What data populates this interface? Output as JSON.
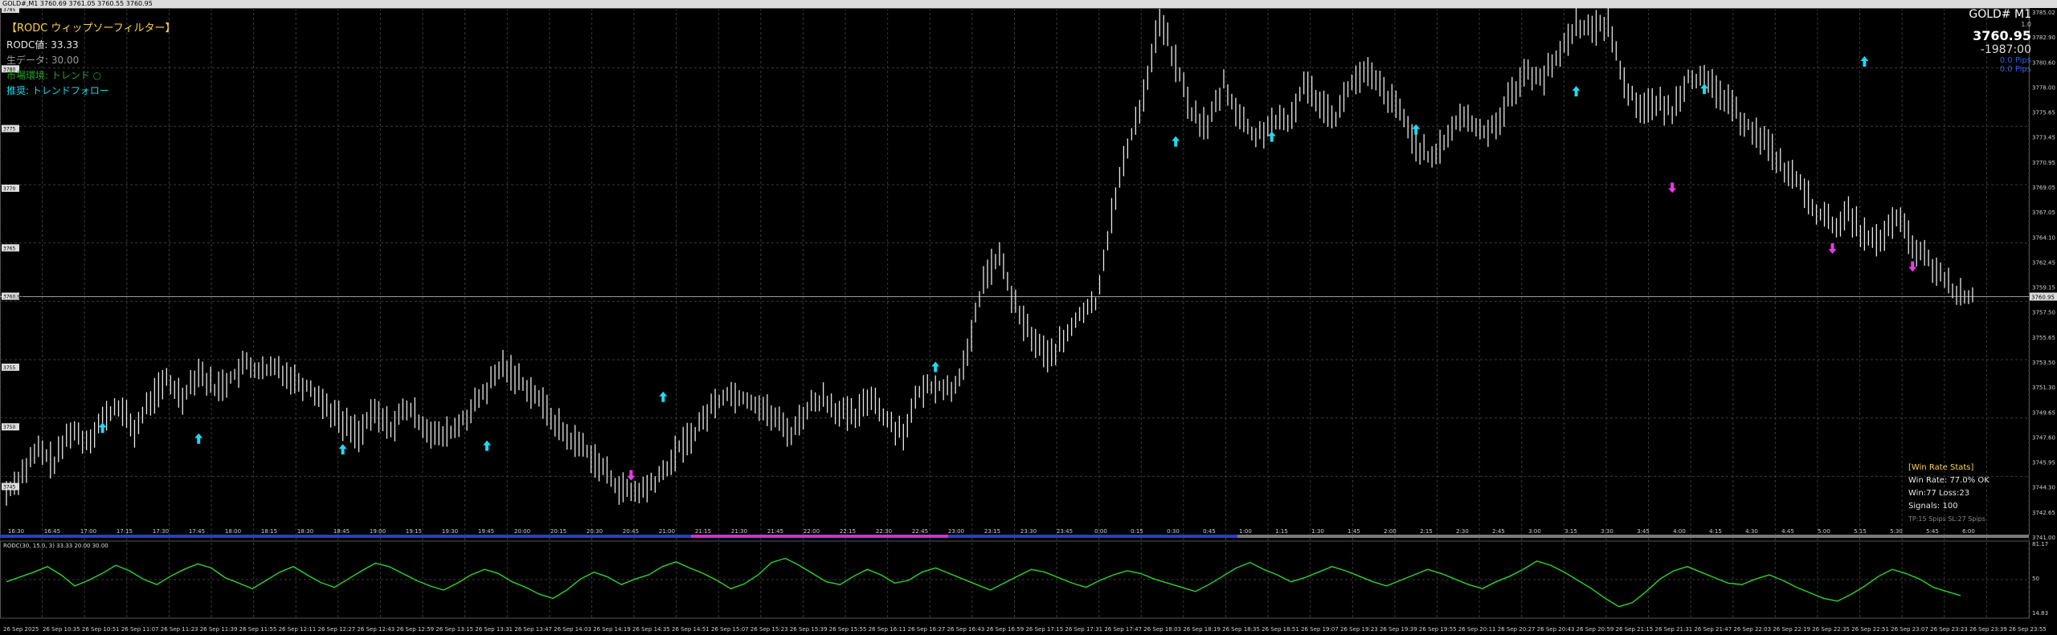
{
  "window": {
    "title": "GOLD#,M1  3760.69 3761.05 3760.55 3760.95"
  },
  "symbol": {
    "name": "GOLD#",
    "timeframe": "M1",
    "spread_ratio": "1.0",
    "price": "3760.95",
    "countdown": "-1987:00",
    "pips1": "0.0 Pips",
    "pips2": "0.0 Pips"
  },
  "indicator_panel": {
    "title": "【RODC ウィップソーフィルター】",
    "value_line": "RODC値: 33.33",
    "raw_line": "生データ: 30.00",
    "env_line": "市場環境: トレンド ○",
    "rec_line": "推奨: トレンドフォロー"
  },
  "stats": {
    "header": "[Win Rate Stats]",
    "win_rate": "Win Rate: 77.0% OK",
    "win_loss": "Win:77 Loss:23",
    "signals": "Signals: 100",
    "tp_sl": "TP:15 Spips SL:27 Spips"
  },
  "subwindow": {
    "title": "RODC(30, 15.0, 3) 33.33 20.00 30.00",
    "levels": [
      "81.17",
      "50",
      "14.83"
    ]
  },
  "price_axis": [
    "3785.02",
    "3782.90",
    "3780.60",
    "3778.00",
    "3775.65",
    "3773.45",
    "3770.95",
    "3769.05",
    "3767.05",
    "3764.10",
    "3762.45",
    "3759.15",
    "3757.50",
    "3755.65",
    "3753.50",
    "3751.30",
    "3749.65",
    "3747.60",
    "3745.95",
    "3744.30",
    "3742.65",
    "3741.00"
  ],
  "axis_marks": [
    "3785",
    "3780",
    "3775",
    "3770",
    "3765",
    "3760.95",
    "3755",
    "3750",
    "3745"
  ],
  "time_strip": [
    "16:30",
    "16:45",
    "17:00",
    "17:15",
    "17:30",
    "17:45",
    "18:00",
    "18:15",
    "18:30",
    "18:45",
    "19:00",
    "19:15",
    "19:30",
    "19:45",
    "20:00",
    "20:15",
    "20:30",
    "20:45",
    "21:00",
    "21:15",
    "21:30",
    "21:45",
    "22:00",
    "22:15",
    "22:30",
    "22:45",
    "23:00",
    "23:15",
    "23:30",
    "23:45",
    "0:00",
    "0:15",
    "0:30",
    "0:45",
    "1:00",
    "1:15",
    "1:30",
    "1:45",
    "2:00",
    "2:15",
    "2:30",
    "2:45",
    "3:00",
    "3:15",
    "3:30",
    "3:45",
    "4:00",
    "4:15",
    "4:30",
    "4:45",
    "5:00",
    "5:15",
    "5:30",
    "5:45",
    "6:00"
  ],
  "bottom_axis": [
    "26 Sep 2025",
    "26 Sep 10:35",
    "26 Sep 10:51",
    "26 Sep 11:07",
    "26 Sep 11:23",
    "26 Sep 11:39",
    "26 Sep 11:55",
    "26 Sep 12:11",
    "26 Sep 12:27",
    "26 Sep 12:43",
    "26 Sep 12:59",
    "26 Sep 13:15",
    "26 Sep 13:31",
    "26 Sep 13:47",
    "26 Sep 14:03",
    "26 Sep 14:19",
    "26 Sep 14:35",
    "26 Sep 14:51",
    "26 Sep 15:07",
    "26 Sep 15:23",
    "26 Sep 15:39",
    "26 Sep 15:55",
    "26 Sep 16:11",
    "26 Sep 16:27",
    "26 Sep 16:43",
    "26 Sep 16:59",
    "26 Sep 17:15",
    "26 Sep 17:31",
    "26 Sep 17:47",
    "26 Sep 18:03",
    "26 Sep 18:19",
    "26 Sep 18:35",
    "26 Sep 18:51",
    "26 Sep 19:07",
    "26 Sep 19:23",
    "26 Sep 19:39",
    "26 Sep 19:55",
    "26 Sep 20:11",
    "26 Sep 20:27",
    "26 Sep 20:43",
    "26 Sep 20:59",
    "26 Sep 21:15",
    "26 Sep 21:31",
    "26 Sep 21:47",
    "26 Sep 22:03",
    "26 Sep 22:19",
    "26 Sep 22:35",
    "26 Sep 22:51",
    "26 Sep 23:07",
    "26 Sep 23:23",
    "26 Sep 23:39",
    "26 Sep 23:55"
  ],
  "chart_data": {
    "type": "line",
    "price_series": [
      3744.5,
      3746.2,
      3748.1,
      3747.0,
      3749.8,
      3748.9,
      3750.6,
      3751.8,
      3749.7,
      3752.3,
      3753.9,
      3752.6,
      3754.8,
      3753.2,
      3754.1,
      3755.3,
      3754.6,
      3755.0,
      3754.0,
      3753.3,
      3751.8,
      3750.4,
      3749.5,
      3751.2,
      3750.0,
      3751.6,
      3750.3,
      3749.1,
      3749.8,
      3751.4,
      3753.2,
      3755.2,
      3754.0,
      3752.8,
      3750.9,
      3749.2,
      3748.4,
      3746.9,
      3745.3,
      3744.4,
      3744.9,
      3746.1,
      3748.3,
      3749.6,
      3751.7,
      3752.9,
      3752.5,
      3751.9,
      3750.7,
      3749.5,
      3751.6,
      3752.5,
      3751.3,
      3750.8,
      3752.8,
      3750.5,
      3749.6,
      3752.9,
      3753.6,
      3753.1,
      3755.9,
      3762.5,
      3764.3,
      3760.0,
      3757.6,
      3755.9,
      3757.2,
      3759.5,
      3760.4,
      3767.8,
      3773.5,
      3777.9,
      3784.2,
      3780.5,
      3776.3,
      3775.2,
      3778.8,
      3776.0,
      3774.2,
      3775.6,
      3775.3,
      3778.8,
      3777.4,
      3776.0,
      3779.0,
      3779.6,
      3778.1,
      3776.4,
      3773.8,
      3772.2,
      3774.6,
      3776.2,
      3774.7,
      3775.4,
      3778.1,
      3779.8,
      3779.3,
      3781.4,
      3783.9,
      3783.2,
      3784.1,
      3778.7,
      3776.9,
      3777.1,
      3776.5,
      3779.5,
      3778.9,
      3778.0,
      3776.3,
      3775.0,
      3773.6,
      3771.6,
      3770.3,
      3768.1,
      3766.9,
      3767.8,
      3766.1,
      3765.4,
      3767.7,
      3765.2,
      3763.9,
      3762.3,
      3760.95
    ],
    "series": [
      {
        "name": "RODC",
        "values": [
          48,
          55,
          62,
          70,
          58,
          42,
          50,
          60,
          72,
          64,
          52,
          44,
          56,
          66,
          74,
          68,
          54,
          46,
          38,
          50,
          62,
          70,
          58,
          47,
          40,
          52,
          64,
          75,
          70,
          60,
          50,
          42,
          36,
          46,
          58,
          66,
          60,
          48,
          40,
          30,
          24,
          36,
          52,
          62,
          55,
          44,
          52,
          58,
          70,
          77,
          68,
          60,
          50,
          38,
          45,
          58,
          76,
          82,
          72,
          60,
          48,
          44,
          56,
          66,
          58,
          46,
          50,
          62,
          68,
          60,
          52,
          44,
          36,
          46,
          56,
          66,
          62,
          54,
          46,
          40,
          50,
          58,
          64,
          60,
          52,
          46,
          40,
          34,
          44,
          56,
          68,
          76,
          66,
          58,
          48,
          54,
          62,
          70,
          64,
          56,
          48,
          42,
          50,
          58,
          66,
          60,
          52,
          44,
          38,
          48,
          56,
          66,
          78,
          72,
          62,
          50,
          38,
          24,
          12,
          18,
          34,
          52,
          64,
          70,
          62,
          54,
          46,
          44,
          52,
          58,
          50,
          40,
          32,
          24,
          20,
          30,
          42,
          56,
          66,
          60,
          52,
          40,
          34,
          28
        ]
      }
    ],
    "buy_arrows": [
      3750.8,
      3749.9,
      3749.0,
      3749.3,
      3753.4,
      3755.9,
      3774.8,
      3775.2,
      3775.8,
      3779.0,
      3779.2,
      3781.5
    ],
    "sell_arrows": [
      3745.2,
      3769.3,
      3764.2,
      3762.7
    ],
    "ylim": [
      3741.0,
      3785.0
    ],
    "sub_ylim": [
      0,
      100
    ]
  }
}
